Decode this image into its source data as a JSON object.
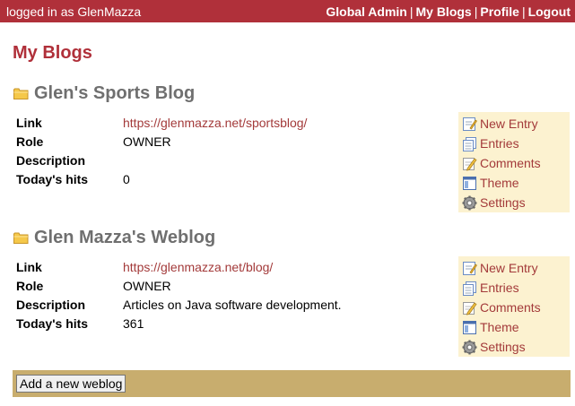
{
  "header": {
    "logged_in_text": "logged in as GlenMazza",
    "menu": [
      {
        "label": "Global Admin"
      },
      {
        "label": "My Blogs"
      },
      {
        "label": "Profile"
      },
      {
        "label": "Logout"
      }
    ],
    "separator": "|",
    "bg_color": "#b0303a"
  },
  "page_title": "My Blogs",
  "prop_labels": {
    "link": "Link",
    "role": "Role",
    "description": "Description",
    "hits": "Today's hits"
  },
  "blogs": [
    {
      "name": "Glen's Sports Blog",
      "link": "https://glenmazza.net/sportsblog/",
      "role": "OWNER",
      "description": "",
      "hits": "0",
      "actions": [
        {
          "label": "New Entry",
          "icon": "new-entry-icon"
        },
        {
          "label": "Entries",
          "icon": "entries-icon"
        },
        {
          "label": "Comments",
          "icon": "comments-icon"
        },
        {
          "label": "Theme",
          "icon": "theme-icon"
        },
        {
          "label": "Settings",
          "icon": "settings-icon"
        }
      ]
    },
    {
      "name": "Glen Mazza's Weblog",
      "link": "https://glenmazza.net/blog/",
      "role": "OWNER",
      "description": "Articles on Java software development.",
      "hits": "361",
      "actions": [
        {
          "label": "New Entry",
          "icon": "new-entry-icon"
        },
        {
          "label": "Entries",
          "icon": "entries-icon"
        },
        {
          "label": "Comments",
          "icon": "comments-icon"
        },
        {
          "label": "Theme",
          "icon": "theme-icon"
        },
        {
          "label": "Settings",
          "icon": "settings-icon"
        }
      ]
    }
  ],
  "add_button": "Add a new weblog"
}
